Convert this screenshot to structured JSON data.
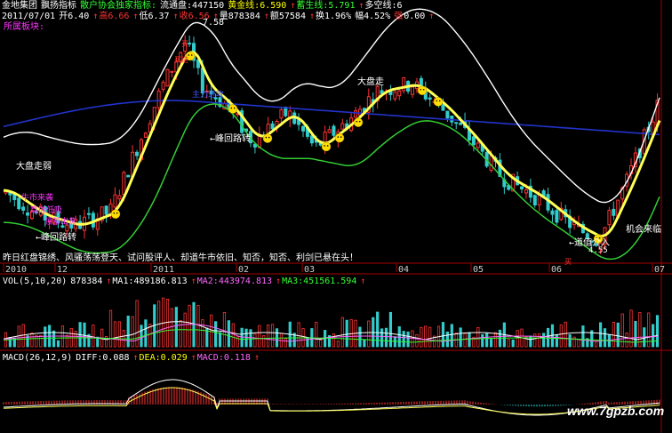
{
  "header": {
    "line1": [
      {
        "text": "金地集团",
        "color": "#ffffff"
      },
      {
        "text": "飘扬指标",
        "color": "#ffffff"
      },
      {
        "text": "散户协会独家指标:",
        "color": "#33ff33"
      },
      {
        "text": "流通盘:447150",
        "color": "#ffffff"
      },
      {
        "text": "黄金线:6.590",
        "color": "#ffff00"
      },
      {
        "text": "↑",
        "color": "#ff3333"
      },
      {
        "text": "蓄生线:5.791",
        "color": "#33ff33"
      },
      {
        "text": "↑",
        "color": "#ff3333"
      },
      {
        "text": "多空线:6",
        "color": "#ffffff"
      }
    ],
    "line2": [
      {
        "text": "2011/07/01",
        "color": "#ffffff"
      },
      {
        "text": "开6.40",
        "color": "#ffffff"
      },
      {
        "text": "↑",
        "color": "#ff3333"
      },
      {
        "text": "高6.66",
        "color": "#ff3333"
      },
      {
        "text": "↑",
        "color": "#ff3333"
      },
      {
        "text": "低6.37",
        "color": "#ffffff"
      },
      {
        "text": "↑",
        "color": "#ff3333"
      },
      {
        "text": "收6.56",
        "color": "#ff3333"
      },
      {
        "text": "↑",
        "color": "#ff3333"
      },
      {
        "text": "量878384",
        "color": "#ffffff"
      },
      {
        "text": "↑",
        "color": "#ff3333"
      },
      {
        "text": "额57584",
        "color": "#ffffff"
      },
      {
        "text": "↑",
        "color": "#ff3333"
      },
      {
        "text": "换1.96%",
        "color": "#ffffff"
      },
      {
        "text": "幅4.52%",
        "color": "#ffffff"
      },
      {
        "text": "强",
        "color": "#ff3333"
      },
      {
        "text": "0.00",
        "color": "#ffffff"
      },
      {
        "text": "↑",
        "color": "#ff3333"
      }
    ],
    "sector": "所属板块:"
  },
  "annotations": {
    "high_price": "7.58",
    "low_price": "4.55",
    "dapan_weak": "大盘走弱",
    "dapan_strong": "大盘走",
    "peak_escape_1": "←峰回路转",
    "peak_escape_2": "←峰回路转",
    "opportunity": "机会来临",
    "value_buy": "←道值介入",
    "buy_in": "买进",
    "blue_label": "主力进攻",
    "buy_word": "买",
    "small_red": "买",
    "magenta1": "牛市来袭",
    "magenta2": "高抛低吸",
    "magenta3": "顶部出货"
  },
  "poem": "昨日红盘锦绣、风骚荡荡登天、试问股评人、却道牛市依旧、知否，知否、利剑已悬在头！",
  "date_axis": [
    "2010",
    "12",
    "2011",
    "02",
    "03",
    "04",
    "05",
    "06",
    "07"
  ],
  "vol_legend": [
    {
      "text": "VOL(5,10,20)",
      "color": "#ffffff"
    },
    {
      "text": "878384",
      "color": "#ffffff"
    },
    {
      "text": "↑",
      "color": "#ff3333"
    },
    {
      "text": "MA1:489186.813",
      "color": "#ffffff"
    },
    {
      "text": "↑",
      "color": "#ff3333"
    },
    {
      "text": "MA2:443974.813",
      "color": "#ff66ff"
    },
    {
      "text": "↑",
      "color": "#ff3333"
    },
    {
      "text": "MA3:451561.594",
      "color": "#33ff33"
    },
    {
      "text": "↑",
      "color": "#ff3333"
    }
  ],
  "macd_legend": [
    {
      "text": "MACD(26,12,9)",
      "color": "#ffffff"
    },
    {
      "text": "DIFF:0.088",
      "color": "#ffffff"
    },
    {
      "text": "↑",
      "color": "#ff3333"
    },
    {
      "text": "DEA:0.029",
      "color": "#ffff00"
    },
    {
      "text": "↑",
      "color": "#ff3333"
    },
    {
      "text": "MACD:0.118",
      "color": "#ff66ff"
    },
    {
      "text": "↑",
      "color": "#ff3333"
    }
  ],
  "watermark": "www.7gpzb.com",
  "colors": {
    "up": "#ff3333",
    "down": "#33cccc",
    "golden_line": "#ffff55",
    "green_line": "#33cc33",
    "white_line": "#ffffff",
    "blue_line": "#2233cc",
    "axis": "#aa0000"
  },
  "chart_data": {
    "type": "line",
    "panels": [
      "price",
      "volume",
      "macd"
    ],
    "x": [
      "2010-11",
      "2010-12",
      "2011-01",
      "2011-02",
      "2011-03",
      "2011-04",
      "2011-05",
      "2011-06",
      "2011-07"
    ],
    "price": {
      "high": 7.58,
      "low": 4.55,
      "close": [
        5.3,
        4.9,
        6.9,
        6.1,
        6.3,
        6.7,
        5.6,
        4.8,
        6.56
      ],
      "golden_line": [
        5.1,
        4.8,
        6.5,
        6.3,
        6.4,
        6.6,
        5.9,
        4.9,
        6.59
      ],
      "green_line": [
        4.8,
        4.6,
        5.3,
        5.6,
        5.8,
        5.9,
        5.5,
        4.6,
        5.79
      ]
    },
    "volume": {
      "last": 878384,
      "MA1": 489186.813,
      "MA2": 443974.813,
      "MA3": 451561.594
    },
    "macd": {
      "DIFF": 0.088,
      "DEA": 0.029,
      "MACD": 0.118
    }
  }
}
